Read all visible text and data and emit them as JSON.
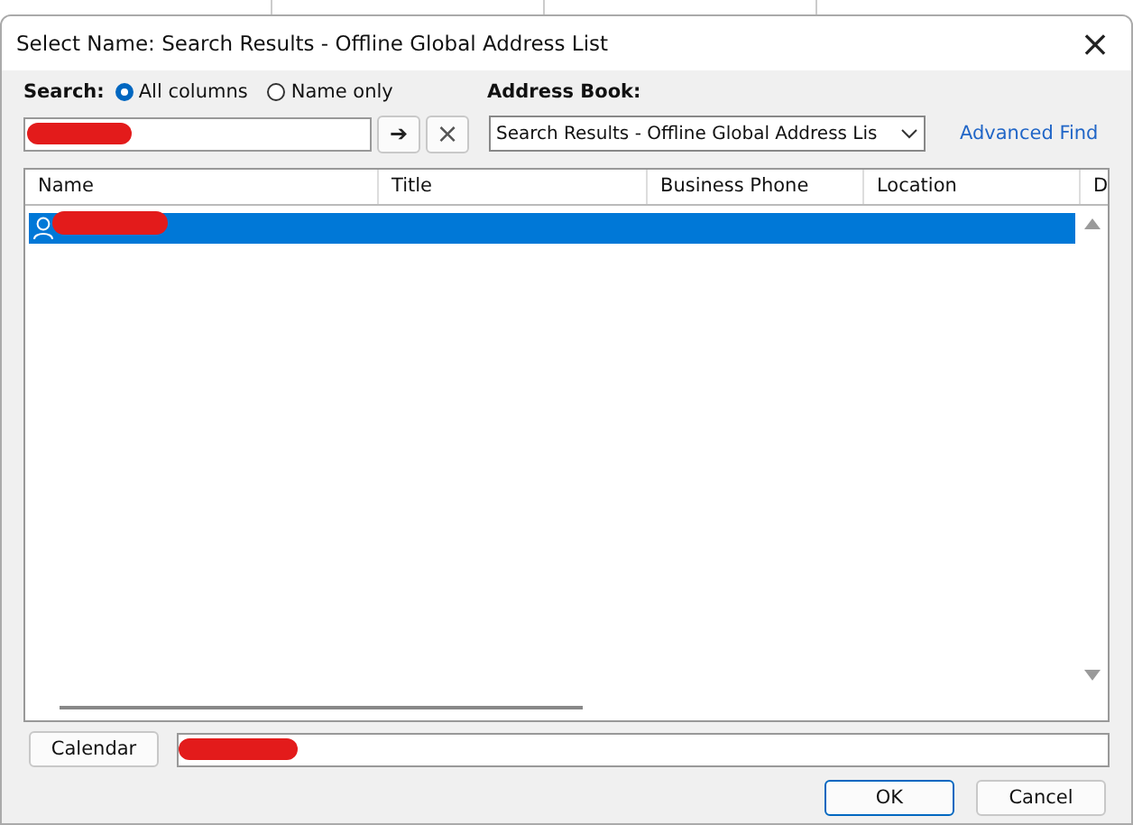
{
  "window": {
    "title": "Select Name: Search Results - Offline Global Address List",
    "close": "×"
  },
  "search": {
    "label": "Search:",
    "modes": [
      {
        "label": "All columns",
        "selected": true
      },
      {
        "label": "Name only",
        "selected": false
      }
    ],
    "go": "➔",
    "clear": "×"
  },
  "address_book": {
    "label": "Address Book:",
    "value": "Search Results - Offline Global Address Lis",
    "link": "Advanced Find"
  },
  "table": {
    "columns": [
      "Name",
      "Title",
      "Business Phone",
      "Location",
      "D"
    ],
    "rows": [
      {
        "selected": true
      }
    ]
  },
  "calendar_button": "Calendar",
  "buttons": [
    {
      "label": "OK",
      "default": true
    },
    {
      "label": "Cancel",
      "default": false
    }
  ]
}
